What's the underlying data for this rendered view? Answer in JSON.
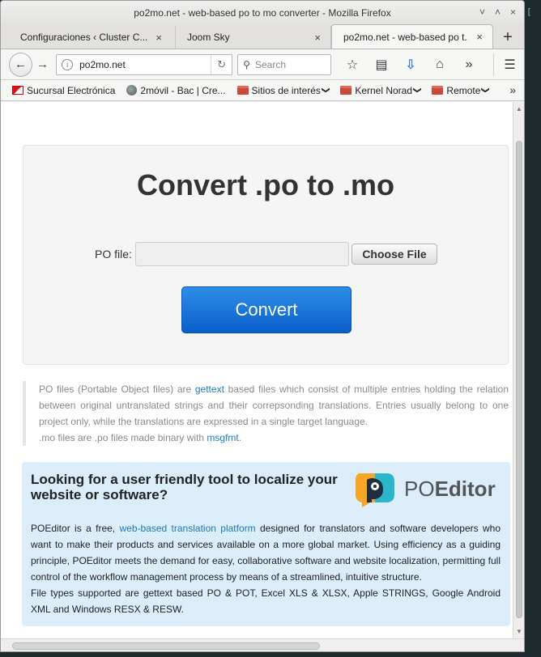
{
  "window": {
    "title": "po2mo.net - web-based po to mo converter - Mozilla Firefox",
    "controls": [
      "˅",
      "˄",
      "×"
    ]
  },
  "tabs": [
    {
      "label": "Configuraciones ‹ Cluster C...",
      "close": "×"
    },
    {
      "label": "Joom Sky",
      "close": "×"
    },
    {
      "label": "po2mo.net - web-based po t...",
      "close": "×",
      "active": true
    }
  ],
  "newtab": "+",
  "nav": {
    "url": "po2mo.net",
    "search_placeholder": "Search"
  },
  "bookmarks": [
    {
      "label": "Sucursal Electrónica",
      "icon": "sucursal-icon"
    },
    {
      "label": "2móvil - Bac | Cre...",
      "icon": "globe-icon"
    },
    {
      "label": "Sitios de interés",
      "icon": "folder-icon",
      "caret": "❯"
    },
    {
      "label": "Kernel Norad",
      "icon": "folder-icon",
      "caret": "❯"
    },
    {
      "label": "Remote",
      "icon": "folder-icon",
      "caret": "❯"
    }
  ],
  "bookmarks_more": "»",
  "main": {
    "heading": "Convert .po to .mo",
    "po_label": "PO file:",
    "choose_button": "Choose File",
    "convert_button": "Convert"
  },
  "description": {
    "p1_a": "PO files (Portable Object files) are ",
    "p1_link": "gettext",
    "p1_b": " based files which consist of multiple entries holding the relation between original untranslated strings and their correpsonding translations. Entries usually belong to one project only, while the translations are expressed in a single target language.",
    "p2_a": ".mo files are .po files made binary with ",
    "p2_link": "msgfmt",
    "p2_b": "."
  },
  "promo": {
    "title": "Looking for a user friendly tool to localize your website or software?",
    "logo_text_a": "PO",
    "logo_text_b": "Editor",
    "body_a": "POEditor is a free, ",
    "body_link": "web-based translation platform",
    "body_b": " designed for translators and software developers who want to make their products and services available on a more global market. Using efficiency as a guiding principle, POEditor meets the demand for easy, collaborative software and website localization, permitting full control of the workflow management process by means of a streamlined, intuitive structure.",
    "body_c": "File types supported are gettext based PO & POT, Excel XLS & XLSX, Apple STRINGS, Google Android XML and Windows RESX & RESW."
  }
}
